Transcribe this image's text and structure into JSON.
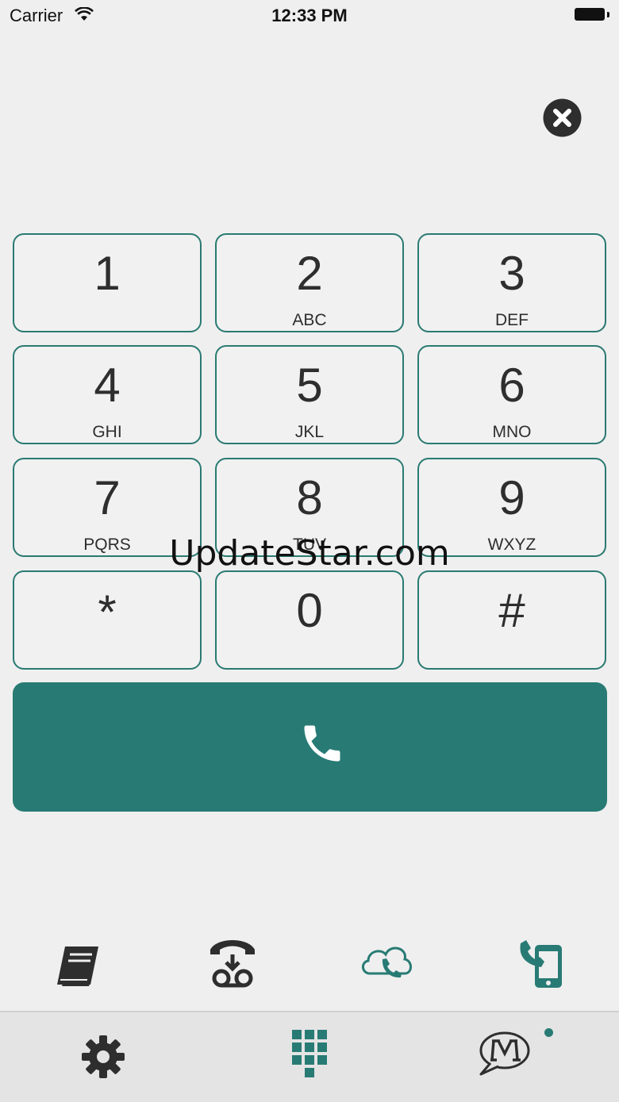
{
  "status_bar": {
    "carrier": "Carrier",
    "time": "12:33 PM"
  },
  "keypad": {
    "keys": [
      {
        "digit": "1",
        "letters": ""
      },
      {
        "digit": "2",
        "letters": "ABC"
      },
      {
        "digit": "3",
        "letters": "DEF"
      },
      {
        "digit": "4",
        "letters": "GHI"
      },
      {
        "digit": "5",
        "letters": "JKL"
      },
      {
        "digit": "6",
        "letters": "MNO"
      },
      {
        "digit": "7",
        "letters": "PQRS"
      },
      {
        "digit": "8",
        "letters": "TUV"
      },
      {
        "digit": "9",
        "letters": "WXYZ"
      },
      {
        "digit": "*",
        "letters": ""
      },
      {
        "digit": "0",
        "letters": ""
      },
      {
        "digit": "#",
        "letters": ""
      }
    ]
  },
  "watermark": "UpdateStar.com",
  "actions": [
    "contacts-book-icon",
    "voicemail-icon",
    "cloud-call-icon",
    "mobile-call-icon"
  ],
  "tabs": [
    "settings-icon",
    "dialpad-icon",
    "messages-icon"
  ],
  "colors": {
    "accent": "#287b74",
    "background": "#efefef",
    "dark": "#333333"
  }
}
